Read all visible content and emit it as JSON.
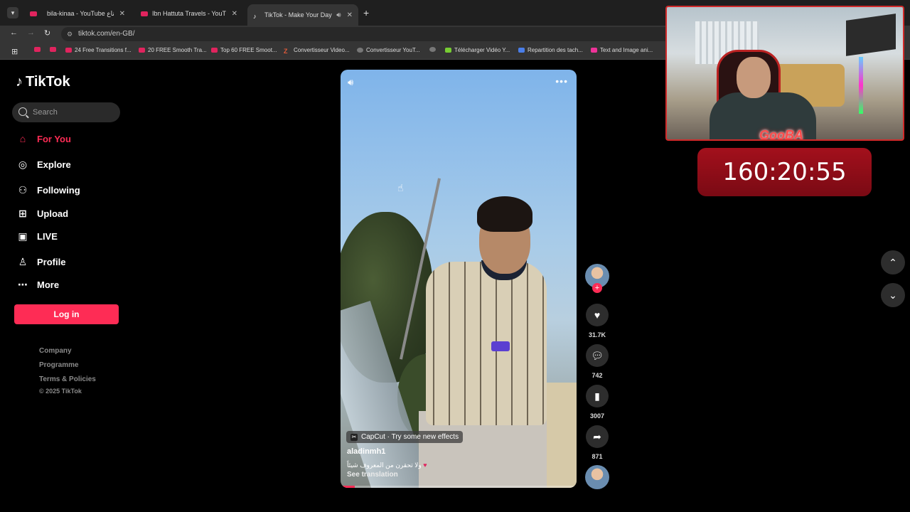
{
  "browser": {
    "tabs": [
      {
        "title": "bila-kinaa - YouTube بلا قناع",
        "active": false
      },
      {
        "title": "Ibn Hattuta Travels - YouTube",
        "active": false
      },
      {
        "title": "TikTok - Make Your Day",
        "active": true
      }
    ],
    "url": "tiktok.com/en-GB/",
    "bookmarks": [
      "24 Free Transitions f...",
      "20 FREE Smooth Tra...",
      "Top 60 FREE Smoot...",
      "Convertisseur Video...",
      "Convertisseur YouT...",
      "Télécharger Vidéo Y...",
      "Repartition des tach...",
      "Text and Image ani..."
    ]
  },
  "sidebar": {
    "logo": "TikTok",
    "search_placeholder": "Search",
    "nav": [
      {
        "label": "For You",
        "icon": "home-icon",
        "active": true
      },
      {
        "label": "Explore",
        "icon": "compass-icon",
        "active": false
      },
      {
        "label": "Following",
        "icon": "following-icon",
        "active": false
      },
      {
        "label": "Upload",
        "icon": "upload-icon",
        "active": false
      },
      {
        "label": "LIVE",
        "icon": "live-icon",
        "active": false
      },
      {
        "label": "Profile",
        "icon": "profile-icon",
        "active": false
      },
      {
        "label": "More",
        "icon": "more-icon",
        "active": false
      }
    ],
    "login_label": "Log in",
    "footer": [
      "Company",
      "Programme",
      "Terms & Policies"
    ],
    "copyright": "© 2025 TikTok"
  },
  "video": {
    "effect_label": "CapCut · Try some new effects",
    "author": "aladinmh1",
    "caption": "ولا تحقرن من المعروف شيئاً",
    "translate_label": "See translation",
    "progress": 0.06
  },
  "actions": {
    "likes": "31.7K",
    "comments": "742",
    "saves": "3007",
    "shares": "871"
  },
  "overlay": {
    "webcam_tag": "GooBA",
    "timer": "160:20:55"
  },
  "colors": {
    "accent": "#fe2c55",
    "timer_bg": "#a3101c"
  }
}
